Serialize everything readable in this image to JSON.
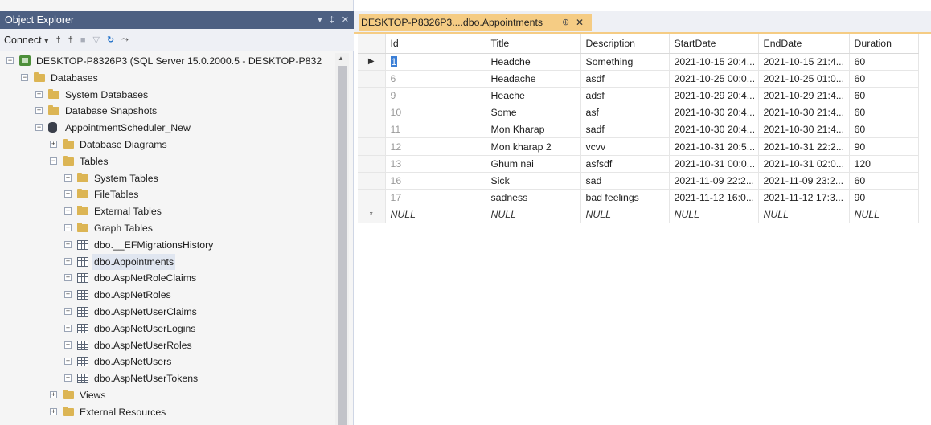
{
  "object_explorer": {
    "title": "Object Explorer",
    "title_pin": "▾",
    "title_autohide": "‡",
    "title_close": "✕",
    "toolbar": {
      "connect_label": "Connect",
      "connect_caret": "▾",
      "connect_icon": "†",
      "disconnect_icon": "†",
      "stop_icon": "■",
      "filter_icon": "▽",
      "refresh_icon": "↻",
      "activity_icon": "⤳"
    },
    "tree": [
      {
        "level": 0,
        "icon": "server-icon",
        "exp": "−",
        "label": "DESKTOP-P8326P3 (SQL Server 15.0.2000.5 - DESKTOP-P832"
      },
      {
        "level": 1,
        "icon": "folder-icon",
        "exp": "−",
        "label": "Databases"
      },
      {
        "level": 2,
        "icon": "folder-icon",
        "exp": "+",
        "label": "System Databases"
      },
      {
        "level": 2,
        "icon": "folder-icon",
        "exp": "+",
        "label": "Database Snapshots"
      },
      {
        "level": 2,
        "icon": "database-icon",
        "exp": "−",
        "label": "AppointmentScheduler_New"
      },
      {
        "level": 3,
        "icon": "folder-icon",
        "exp": "+",
        "label": "Database Diagrams"
      },
      {
        "level": 3,
        "icon": "folder-icon",
        "exp": "−",
        "label": "Tables"
      },
      {
        "level": 4,
        "icon": "folder-icon",
        "exp": "+",
        "label": "System Tables"
      },
      {
        "level": 4,
        "icon": "folder-icon",
        "exp": "+",
        "label": "FileTables"
      },
      {
        "level": 4,
        "icon": "folder-icon",
        "exp": "+",
        "label": "External Tables"
      },
      {
        "level": 4,
        "icon": "folder-icon",
        "exp": "+",
        "label": "Graph Tables"
      },
      {
        "level": 4,
        "icon": "table-icon",
        "exp": "+",
        "label": "dbo.__EFMigrationsHistory"
      },
      {
        "level": 4,
        "icon": "table-icon",
        "exp": "+",
        "label": "dbo.Appointments",
        "selected": true
      },
      {
        "level": 4,
        "icon": "table-icon",
        "exp": "+",
        "label": "dbo.AspNetRoleClaims"
      },
      {
        "level": 4,
        "icon": "table-icon",
        "exp": "+",
        "label": "dbo.AspNetRoles"
      },
      {
        "level": 4,
        "icon": "table-icon",
        "exp": "+",
        "label": "dbo.AspNetUserClaims"
      },
      {
        "level": 4,
        "icon": "table-icon",
        "exp": "+",
        "label": "dbo.AspNetUserLogins"
      },
      {
        "level": 4,
        "icon": "table-icon",
        "exp": "+",
        "label": "dbo.AspNetUserRoles"
      },
      {
        "level": 4,
        "icon": "table-icon",
        "exp": "+",
        "label": "dbo.AspNetUsers"
      },
      {
        "level": 4,
        "icon": "table-icon",
        "exp": "+",
        "label": "dbo.AspNetUserTokens"
      },
      {
        "level": 3,
        "icon": "folder-icon",
        "exp": "+",
        "label": "Views"
      },
      {
        "level": 3,
        "icon": "folder-icon",
        "exp": "+",
        "label": "External Resources"
      }
    ],
    "scroll_up": "▲"
  },
  "document": {
    "tab_title": "DESKTOP-P8326P3....dbo.Appointments",
    "tab_pin": "⊕",
    "tab_close": "✕"
  },
  "grid": {
    "columns": [
      "Id",
      "Title",
      "Description",
      "StartDate",
      "EndDate",
      "Duration"
    ],
    "current_row_marker": "▶",
    "new_row_marker": "*",
    "rows": [
      [
        "1",
        "Headche",
        "Something",
        "2021-10-15 20:4...",
        "2021-10-15 21:4...",
        "60"
      ],
      [
        "6",
        "Headache",
        "asdf",
        "2021-10-25 00:0...",
        "2021-10-25 01:0...",
        "60"
      ],
      [
        "9",
        "Heache",
        "adsf",
        "2021-10-29 20:4...",
        "2021-10-29 21:4...",
        "60"
      ],
      [
        "10",
        "Some",
        "asf",
        "2021-10-30 20:4...",
        "2021-10-30 21:4...",
        "60"
      ],
      [
        "11",
        "Mon Kharap",
        "sadf",
        "2021-10-30 20:4...",
        "2021-10-30 21:4...",
        "60"
      ],
      [
        "12",
        "Mon kharap 2",
        "vcvv",
        "2021-10-31 20:5...",
        "2021-10-31 22:2...",
        "90"
      ],
      [
        "13",
        "Ghum nai",
        "asfsdf",
        "2021-10-31 00:0...",
        "2021-10-31 02:0...",
        "120"
      ],
      [
        "16",
        "Sick",
        "sad",
        "2021-11-09 22:2...",
        "2021-11-09 23:2...",
        "60"
      ],
      [
        "17",
        "sadness",
        "bad feelings",
        "2021-11-12 16:0...",
        "2021-11-12 17:3...",
        "90"
      ]
    ],
    "null_row": [
      "NULL",
      "NULL",
      "NULL",
      "NULL",
      "NULL",
      "NULL"
    ]
  }
}
